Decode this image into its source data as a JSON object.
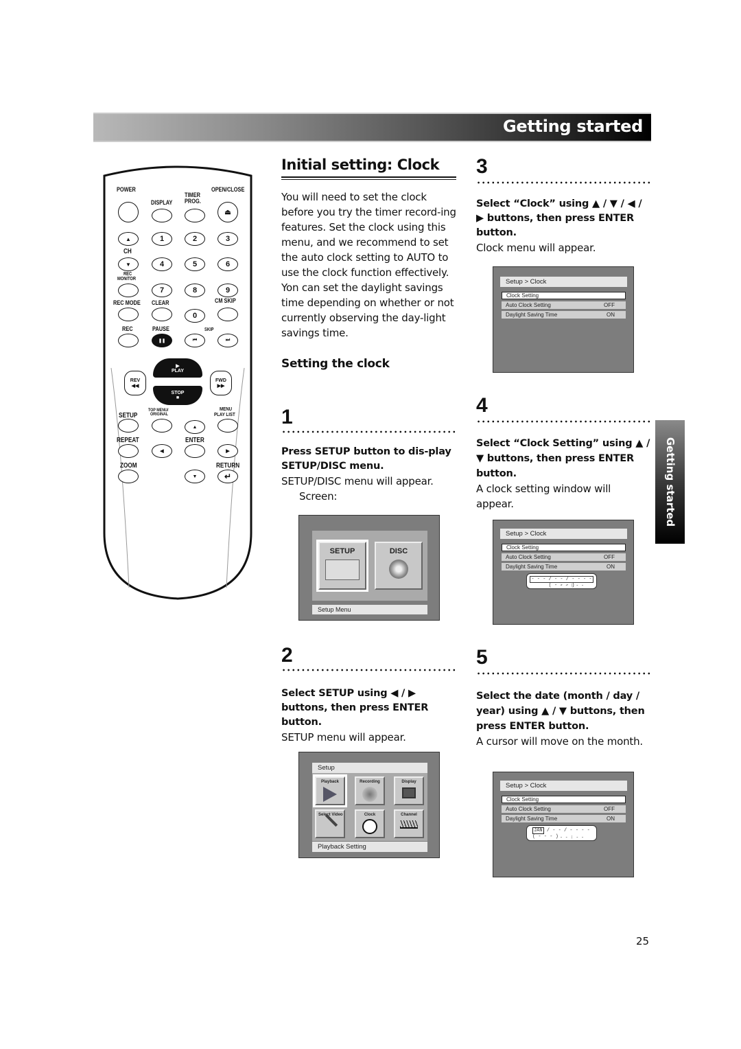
{
  "header": {
    "title": "Getting started"
  },
  "side_tab": {
    "label": "Getting started"
  },
  "remote": {
    "labels": {
      "power": "POWER",
      "display": "DISPLAY",
      "timer_prog": "TIMER PROG.",
      "open_close": "OPEN/CLOSE",
      "ch": "CH",
      "rec_monitor_1": "REC",
      "rec_monitor_2": "MONITOR",
      "rec_mode": "REC MODE",
      "clear": "CLEAR",
      "cm_skip": "CM SKIP",
      "rec": "REC",
      "pause": "PAUSE",
      "skip": "SKIP",
      "rev": "REV",
      "fwd": "FWD",
      "play": "PLAY",
      "stop": "STOP",
      "setup": "SETUP",
      "top_menu_1": "TOP MENU/",
      "top_menu_2": "ORIGINAL",
      "menu_1": "MENU",
      "menu_2": "PLAY LIST",
      "repeat": "REPEAT",
      "enter": "ENTER",
      "zoom": "ZOOM",
      "return": "RETURN"
    },
    "digits": [
      "1",
      "2",
      "3",
      "4",
      "5",
      "6",
      "7",
      "8",
      "9",
      "0"
    ],
    "glyphs": {
      "eject": "⏏",
      "up": "▲",
      "down": "▼",
      "left": "◀",
      "right": "▶",
      "pause": "❚❚",
      "skip_back": "⏮",
      "skip_fwd": "⏭",
      "rew": "◀◀",
      "ff": "▶▶",
      "play": "▶",
      "stop": "■",
      "return": "↵"
    }
  },
  "intro": {
    "title": "Initial setting: Clock",
    "paragraph1": "You will need to set the clock before you try the timer record-ing features. Set the clock using this menu, and we recommend to set the auto clock setting to AUTO to use the clock function effectively.",
    "paragraph2": "Yon can set the daylight savings time depending on whether or not currently observing the day-light savings time.",
    "subheading": "Setting the clock"
  },
  "steps": [
    {
      "num": "1",
      "instruction": "Press SETUP button to dis-play SETUP/DISC menu.",
      "result": "SETUP/DISC menu will appear.",
      "extra": "Screen:"
    },
    {
      "num": "2",
      "instruction": "Select SETUP using ◀ / ▶ buttons, then press ENTER button.",
      "result": "SETUP menu will appear."
    },
    {
      "num": "3",
      "instruction": "Select “Clock” using ▲ / ▼ / ◀ / ▶ buttons, then press ENTER button.",
      "result": "Clock menu will appear."
    },
    {
      "num": "4",
      "instruction": "Select “Clock Setting” using ▲ / ▼ buttons, then press ENTER button.",
      "result": "A clock setting window will appear."
    },
    {
      "num": "5",
      "instruction": "Select the date (month / day / year) using ▲ / ▼ buttons, then press ENTER button.",
      "result": "A cursor will move on the month."
    }
  ],
  "screens": {
    "setup_disc": {
      "tiles": [
        "SETUP",
        "DISC"
      ],
      "footer": "Setup Menu"
    },
    "setup": {
      "title": "Setup",
      "tiles": [
        "Playback",
        "Recording",
        "Display",
        "Select Video",
        "Clock",
        "Channel"
      ],
      "footer": "Playback Setting"
    },
    "clock": {
      "title": "Setup > Clock",
      "rows": [
        {
          "label": "Clock Setting",
          "value": ""
        },
        {
          "label": "Auto Clock Setting",
          "value": "OFF"
        },
        {
          "label": "Daylight Saving Time",
          "value": "ON"
        }
      ],
      "date_blank": "- - - / - - / - - - - ( - - - )",
      "time_blank": "- - : - -",
      "month_cursor": "JAN",
      "date_rest": "/ - - / - - - - ( - - - )"
    }
  },
  "page_number": "25"
}
